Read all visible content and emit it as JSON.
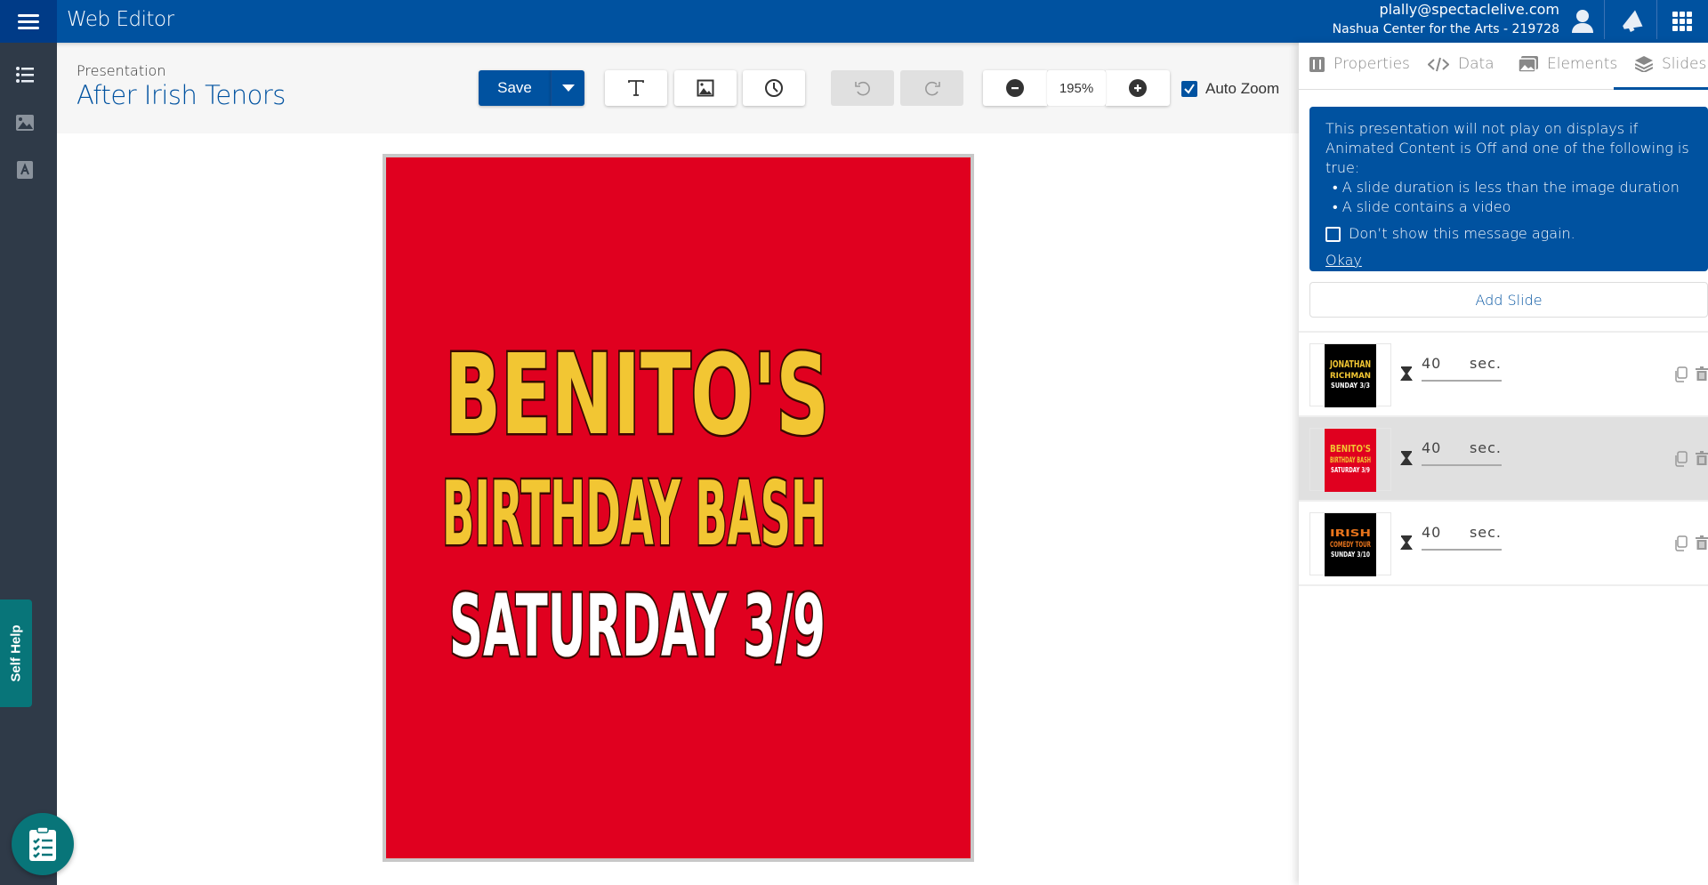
{
  "header": {
    "app_title": "Web Editor",
    "user_email": "plally@spectaclelive.com",
    "org": "Nashua Center for the Arts - 219728",
    "brand_color": "#0052a0"
  },
  "sidebar": {
    "self_help": "Self Help",
    "icons": [
      "list-icon",
      "image-icon",
      "template-icon"
    ]
  },
  "presentation": {
    "label": "Presentation",
    "name": "After Irish Tenors"
  },
  "toolbar": {
    "save": "Save",
    "zoom": "195%",
    "auto_zoom": "Auto Zoom",
    "auto_zoom_checked": true
  },
  "slide": {
    "line1": "BENITO'S",
    "line2": "BIRTHDAY BASH",
    "line3": "SATURDAY 3/9",
    "background": "#e0001f",
    "text_color": "#f2c633"
  },
  "panel": {
    "tabs": [
      {
        "label": "Properties"
      },
      {
        "label": "Data"
      },
      {
        "label": "Elements"
      },
      {
        "label": "Slides",
        "active": true
      }
    ],
    "notice": {
      "text": "This presentation will not play on displays if Animated Content is Off and one of the following is true:",
      "bullets": [
        "A slide duration is less than the image duration",
        "A slide contains a video"
      ],
      "dont_show": "Don’t show this message again.",
      "okay": "Okay"
    },
    "add_slide": "Add Slide",
    "slides": [
      {
        "lines": [
          "JONATHAN",
          "RICHMAN",
          "SUNDAY 3/3"
        ],
        "duration": "40",
        "unit": "sec."
      },
      {
        "lines": [
          "BENITO'S",
          "BIRTHDAY BASH",
          "SATURDAY 3/9"
        ],
        "duration": "40",
        "unit": "sec.",
        "selected": true
      },
      {
        "lines": [
          "IRISH",
          "COMEDY TOUR",
          "SUNDAY 3/10"
        ],
        "duration": "40",
        "unit": "sec."
      }
    ]
  }
}
